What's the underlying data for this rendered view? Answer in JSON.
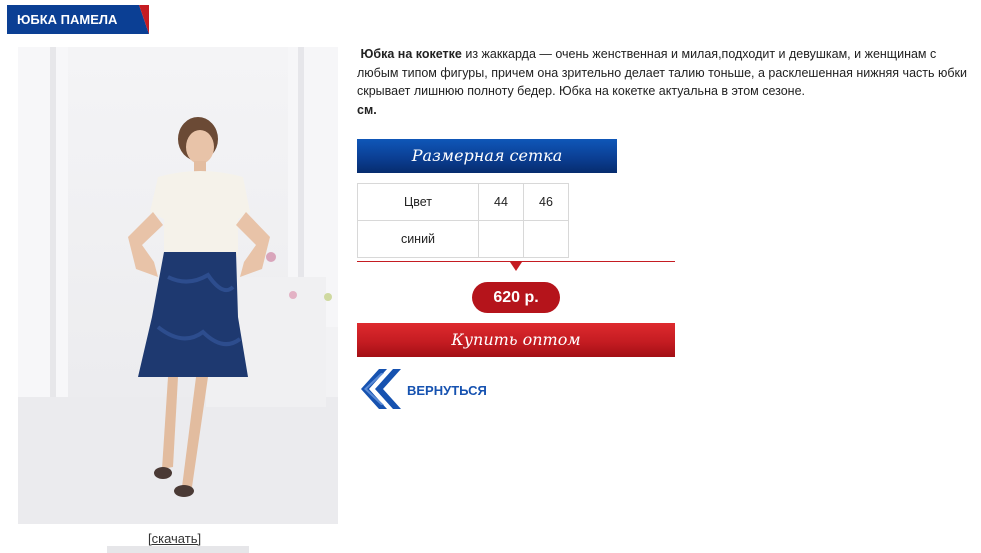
{
  "product": {
    "title": "ЮБКА ПАМЕЛА",
    "download_label": "[скачать]",
    "description": {
      "bold_lead": "Юбка на кокетке",
      "line1_rest": " из жаккарда — очень женственная и милая,подходит и девушкам, и женщинам с",
      "line2": "любым типом фигуры, причем она зрительно делает талию тоньше, а расклешенная нижняя часть юбки",
      "line3": "скрывает лишнюю полноту бедер. Юбка на кокетке актуальна в этом сезоне.",
      "line4": "см."
    },
    "size_grid_title": "Размерная сетка",
    "size_table": {
      "header": [
        "Цвет",
        "44",
        "46"
      ],
      "rows": [
        [
          "синий",
          "",
          ""
        ]
      ]
    },
    "price": "620 р.",
    "buy_label": "Купить оптом",
    "back_label": "ВЕРНУТЬСЯ"
  },
  "colors": {
    "brand_blue": "#0b3f94",
    "accent_red": "#c51c22",
    "link_blue": "#1652b0"
  },
  "icons": {
    "back": "double-chevron-left-icon"
  }
}
